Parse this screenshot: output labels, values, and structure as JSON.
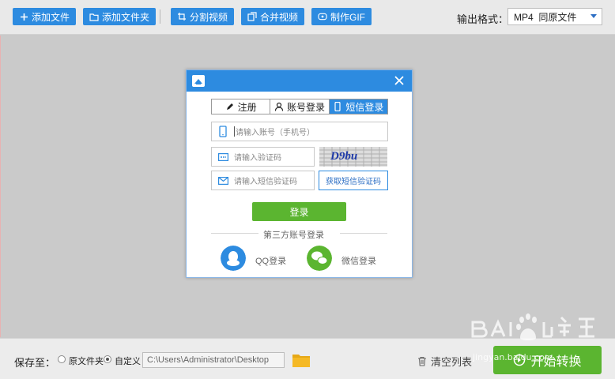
{
  "toolbar": {
    "buttons": [
      {
        "label": "添加文件",
        "icon": "plus-icon"
      },
      {
        "label": "添加文件夹",
        "icon": "folder-icon"
      },
      {
        "label": "分割视频",
        "icon": "crop-icon"
      },
      {
        "label": "合并视频",
        "icon": "merge-icon"
      },
      {
        "label": "制作GIF",
        "icon": "gif-icon"
      }
    ],
    "output_format_label": "输出格式：",
    "output_format_value": "MP4  同原文件"
  },
  "dialog": {
    "title": "",
    "close_icon": "close-icon",
    "tabs": [
      {
        "label": "注册",
        "icon": "pencil-icon",
        "active": false
      },
      {
        "label": "账号登录",
        "icon": "user-icon",
        "active": false
      },
      {
        "label": "短信登录",
        "icon": "phone-icon",
        "active": true
      }
    ],
    "account_placeholder": "请输入账号（手机号）",
    "captcha_placeholder": "请输入验证码",
    "captcha_text": "D9bu",
    "sms_placeholder": "请输入短信验证码",
    "sms_button": "获取短信验证码",
    "login_button": "登录",
    "third_party_label": "第三方账号登录",
    "qq_label": "QQ登录",
    "wechat_label": "微信登录"
  },
  "bottombar": {
    "save_to_label": "保存至：",
    "radio_original": "原文件夹",
    "radio_custom": "自定义",
    "custom_selected": true,
    "path_value": "C:\\Users\\Administrator\\Desktop",
    "clear_list_label": "清空列表",
    "start_button_label": "开始转换"
  },
  "watermark": {
    "text": "jingyan.baidu.com"
  },
  "colors": {
    "primary_blue": "#2d8be0",
    "green": "#5bb530"
  }
}
